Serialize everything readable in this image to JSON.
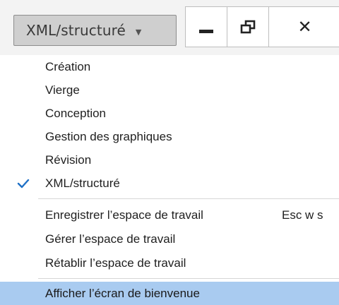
{
  "toolbar": {
    "workspace_selector_label": "XML/structuré",
    "caret_icon": "chevron-down-icon",
    "minimize_icon": "minimize-icon",
    "restore_icon": "restore-icon",
    "close_icon": "close-icon",
    "close_glyph": "✕"
  },
  "menu": {
    "items": [
      {
        "label": "Création"
      },
      {
        "label": "Vierge"
      },
      {
        "label": "Conception"
      },
      {
        "label": "Gestion des graphiques"
      },
      {
        "label": "Révision"
      },
      {
        "label": "XML/structuré",
        "checked": true
      },
      {
        "label": "Enregistrer l’espace de travail",
        "shortcut": "Esc w s"
      },
      {
        "label": "Gérer l’espace de travail"
      },
      {
        "label": "Rétablir l’espace de travail"
      },
      {
        "label": "Afficher l’écran de bienvenue",
        "highlighted": true
      }
    ],
    "highlight_color": "#a9cbf0",
    "check_color": "#1e70c6"
  }
}
